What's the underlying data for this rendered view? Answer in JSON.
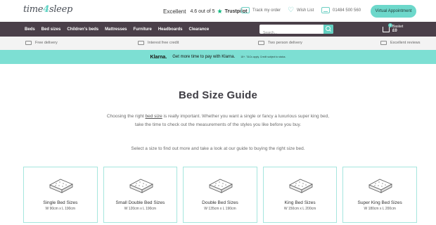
{
  "header": {
    "logo": {
      "part1": "time",
      "part2": "4",
      "part3": "sleep"
    },
    "trustpilot": {
      "label": "Excellent",
      "rating_text": "4.6 out of 5",
      "brand": "Trustpilot"
    },
    "track_order": "Track my order",
    "wish_list": "Wish List",
    "phone": "01484 500 560",
    "appointment_button": "Virtual Appointment"
  },
  "nav": {
    "items": [
      "Beds",
      "Bed sizes",
      "Children's beds",
      "Mattresses",
      "Furniture",
      "Headboards",
      "Clearance"
    ],
    "search_placeholder": "Search...",
    "basket_label": "Basket",
    "basket_value": "£0",
    "basket_count": "0"
  },
  "usps": [
    "Free delivery",
    "Interest free credit",
    "Two person delivery",
    "Excellent reviews"
  ],
  "klarna": {
    "logo": "Klarna.",
    "text": "Get more time to pay with Klarna.",
    "small": "18+. T&Cs apply. Credit subject to status."
  },
  "main": {
    "title": "Bed Size Guide",
    "intro_before": "Choosing the right ",
    "intro_link": "bed size",
    "intro_after": " is really important. Whether you want a single or fancy a luxurious super king bed, take the time to check out the measurements of the styles you like before you buy.",
    "select_text": "Select a size to find out more and take a look at our guide to buying the right size bed."
  },
  "cards": [
    {
      "title": "Single Bed Sizes",
      "dims": "W 90cm x L 190cm"
    },
    {
      "title": "Small Double Bed Sizes",
      "dims": "W 120cm x L 190cm"
    },
    {
      "title": "Double Bed Sizes",
      "dims": "W 135cm x L 190cm"
    },
    {
      "title": "King Bed Sizes",
      "dims": "W 150cm x L 200cm"
    },
    {
      "title": "Super King Bed Sizes",
      "dims": "W 180cm x L 200cm"
    }
  ],
  "colors": {
    "accent": "#6dd8cb",
    "nav_bg": "#4a3f49",
    "klarna_bg": "#7ddfd3",
    "card_border": "#a6e6de"
  }
}
